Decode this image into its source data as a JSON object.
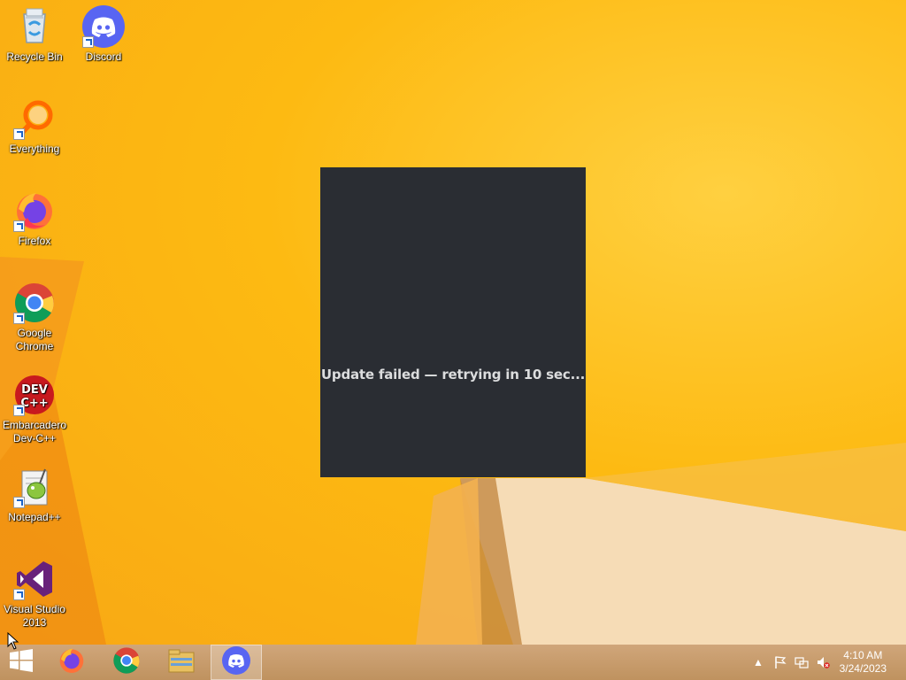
{
  "desktop": {
    "icons": [
      {
        "label": "Recycle Bin"
      },
      {
        "label": "Discord"
      },
      {
        "label": "Everything"
      },
      {
        "label": "Firefox"
      },
      {
        "label": "Google Chrome"
      },
      {
        "label": "Embarcadero Dev-C++"
      },
      {
        "label": "Notepad++"
      },
      {
        "label": "Visual Studio 2013"
      }
    ]
  },
  "update_window": {
    "message": "Update failed — retrying in 10 sec..."
  },
  "taskbar": {
    "start_icon": "windows-logo-icon",
    "pinned": [
      "firefox-icon",
      "chrome-icon",
      "file-explorer-icon",
      "discord-icon"
    ],
    "active": "discord-icon"
  },
  "tray": {
    "time": "4:10 AM",
    "date": "3/24/2023"
  },
  "colors": {
    "wallpaper": "#fdb813",
    "window_bg": "#2a2d33",
    "discord_brand": "#5865f2",
    "taskbar": "#c79a6b"
  }
}
